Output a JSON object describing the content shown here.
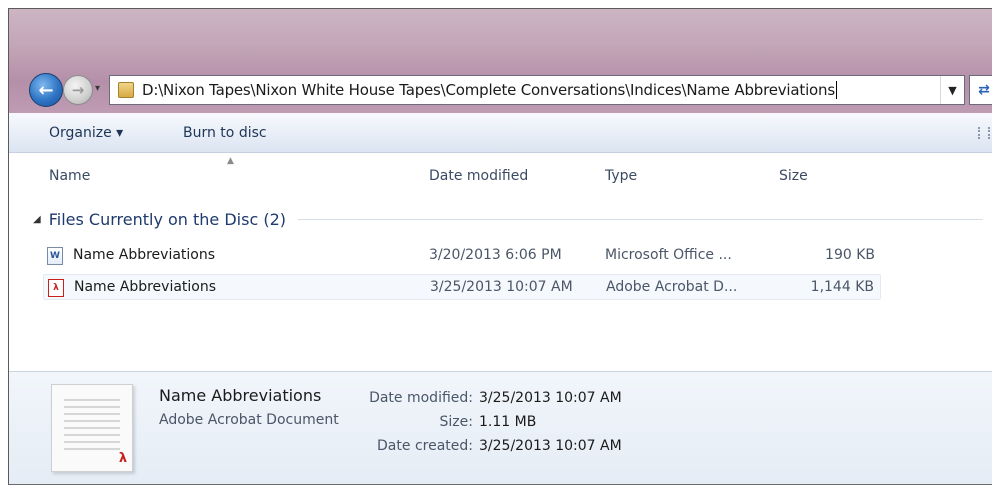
{
  "address_bar": {
    "path": "D:\\Nixon Tapes\\Nixon White House Tapes\\Complete Conversations\\Indices\\Name Abbreviations"
  },
  "toolbar": {
    "organize_label": "Organize ▾",
    "burn_label": "Burn to disc"
  },
  "columns": {
    "name": "Name",
    "date": "Date modified",
    "type": "Type",
    "size": "Size"
  },
  "group": {
    "title": "Files Currently on the Disc (2)"
  },
  "files": [
    {
      "name": "Name Abbreviations",
      "date": "3/20/2013 6:06 PM",
      "type": "Microsoft Office ...",
      "size": "190 KB",
      "icon": "word-document-icon"
    },
    {
      "name": "Name Abbreviations",
      "date": "3/25/2013 10:07 AM",
      "type": "Adobe Acrobat D...",
      "size": "1,144 KB",
      "icon": "pdf-document-icon"
    }
  ],
  "details": {
    "name": "Name Abbreviations",
    "kind": "Adobe Acrobat Document",
    "date_modified_label": "Date modified:",
    "date_modified": "3/25/2013 10:07 AM",
    "size_label": "Size:",
    "size": "1.11 MB",
    "date_created_label": "Date created:",
    "date_created": "3/25/2013 10:07 AM"
  }
}
